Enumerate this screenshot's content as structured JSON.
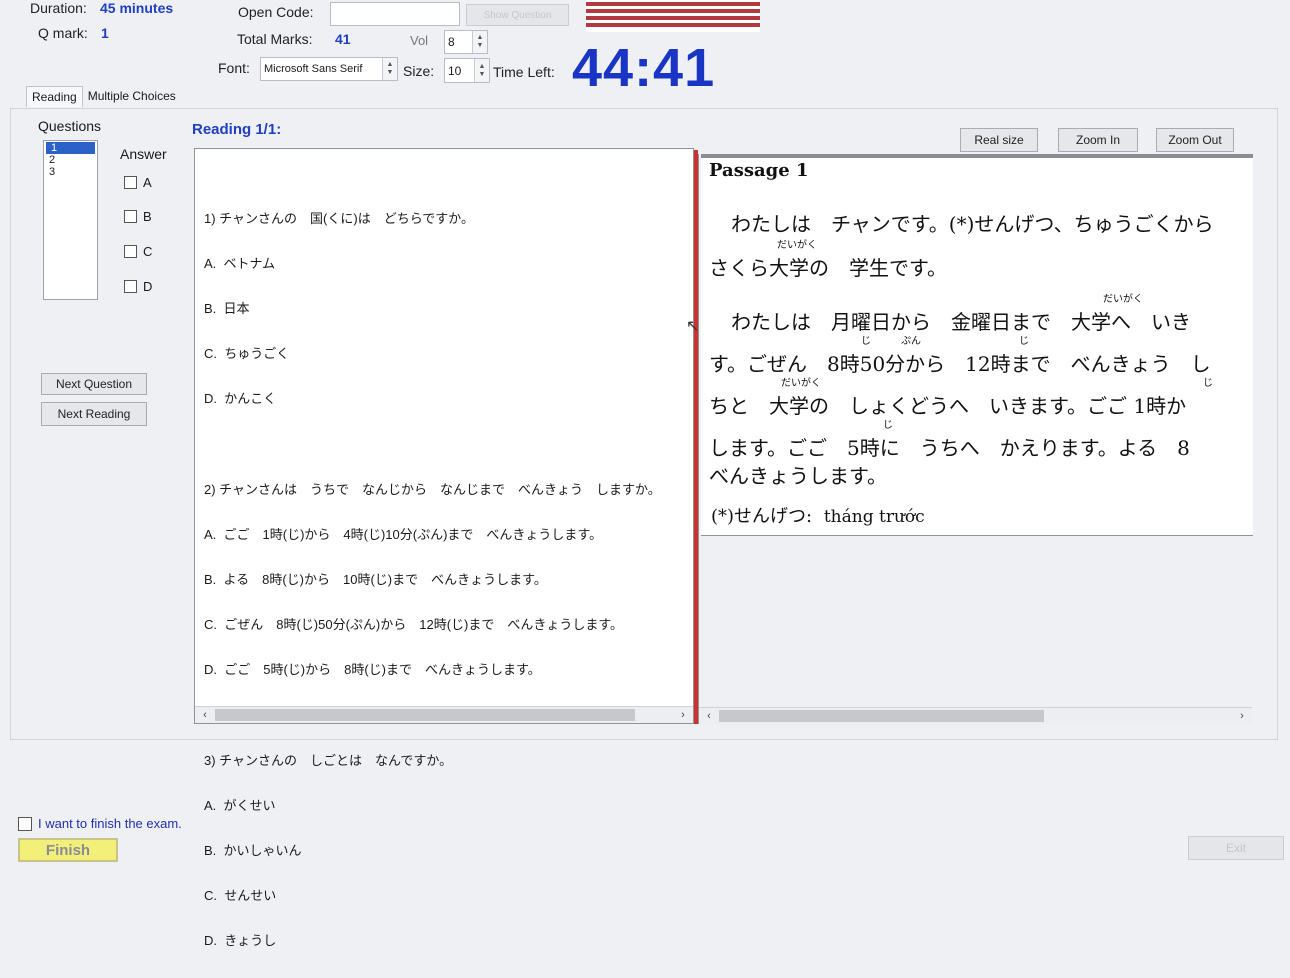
{
  "header": {
    "duration_label": "Duration:",
    "duration_value": "45 minutes",
    "qmark_label": "Q mark:",
    "qmark_value": "1",
    "open_code_label": "Open Code:",
    "open_code_value": "",
    "show_question_label": "Show Question",
    "total_marks_label": "Total Marks:",
    "total_marks_value": "41",
    "vol_label": "Vol",
    "vol_value": "8",
    "font_label": "Font:",
    "font_value": "Microsoft Sans Serif",
    "size_label": "Size:",
    "size_value": "10",
    "time_left_label": "Time Left:",
    "time_left_value": "44:41"
  },
  "tabs": [
    {
      "label": "Reading",
      "active": true
    },
    {
      "label": "Multiple Choices",
      "active": false
    }
  ],
  "questions_panel": {
    "title": "Questions",
    "items": [
      "1",
      "2",
      "3"
    ],
    "selected": "1",
    "answer_title": "Answer",
    "options": [
      "A",
      "B",
      "C",
      "D"
    ],
    "next_question_label": "Next Question",
    "next_reading_label": "Next Reading"
  },
  "reading": {
    "title": "Reading 1/1:",
    "real_size_label": "Real size",
    "zoom_in_label": "Zoom In",
    "zoom_out_label": "Zoom Out"
  },
  "questions_text": [
    {
      "stem": "1) チャンさんの　国(くに)は　どちらですか。",
      "choices": [
        "A.  ベトナム",
        "B.  日本",
        "C.  ちゅうごく",
        "D.  かんこく"
      ]
    },
    {
      "stem": "2) チャンさんは　うちで　なんじから　なんじまで　べんきょう　しますか。",
      "choices": [
        "A.  ごご　1時(じ)から　4時(じ)10分(ぷん)まで　べんきょうします。",
        "B.  よる　8時(じ)から　10時(じ)まで　べんきょうします。",
        "C.  ごぜん　8時(じ)50分(ぷん)から　12時(じ)まで　べんきょうします。",
        "D.  ごご　5時(じ)から　8時(じ)まで　べんきょうします。"
      ]
    },
    {
      "stem": "3) チャンさんの　しごとは　なんですか。",
      "choices": [
        "A.  がくせい",
        "B.  かいしゃいん",
        "C.  せんせい",
        "D.  きょうし"
      ]
    }
  ],
  "passage": {
    "title": "Passage 1",
    "lines": [
      "わたしは　チャンです。(*)せんげつ、ちゅうごくから",
      "さくら大学の　学生です。",
      "わたしは　月曜日から　金曜日まで　大学へ　いき",
      "す。ごぜん　8時50分から　12時まで　べんきょう　し",
      "ちと　大学の　しょくどうへ　いきます。ごご 1時か",
      "します。ごご　5時に　うちへ　かえります。よる　8",
      "べんきょうします。"
    ],
    "furigana": [
      "だいがく",
      "だいがく",
      "じ",
      "ぷん",
      "じ",
      "だいがく",
      "じ",
      "じ"
    ],
    "note_label": "(*)せんげつ:",
    "note_value": "tháng trước"
  },
  "footer": {
    "finish_checkbox_label": "I want to finish the exam.",
    "finish_label": "Finish",
    "exit_label": "Exit"
  },
  "colors": {
    "accent_blue": "#1f3fbf",
    "timer_blue": "#1a35c4",
    "splitter_red": "#c8342f",
    "finish_yellow": "#f3f07a"
  }
}
